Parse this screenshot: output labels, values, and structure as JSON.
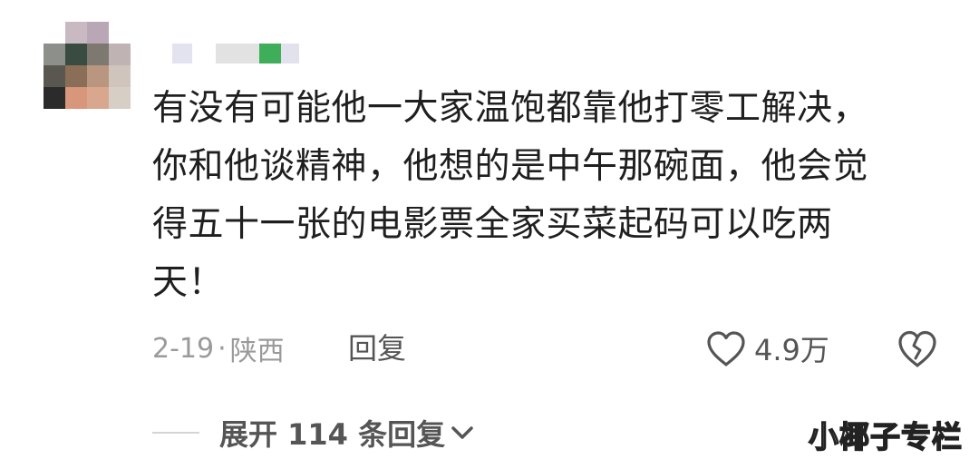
{
  "comment": {
    "lines": [
      "有没有可能他一大家温饱都靠他打零工解决，",
      "你和他谈精神，他想的是中午那碗面，他会觉",
      "得五十一张的电影票全家买菜起码可以吃两",
      "天！"
    ],
    "date": "2-19",
    "separator": "·",
    "location": "陕西",
    "reply_label": "回复",
    "like_count": "4.9万"
  },
  "replies": {
    "expand_label": "展开 114 条回复"
  },
  "watermark": "小椰子专栏",
  "colors": {
    "text_primary": "#1f1f1f",
    "text_meta": "#9a9a9a",
    "text_action": "#555555",
    "username_accent": "#3fae5a"
  },
  "icons": {
    "like": "heart-outline-icon",
    "dislike": "broken-heart-icon",
    "expand": "chevron-down-icon"
  }
}
